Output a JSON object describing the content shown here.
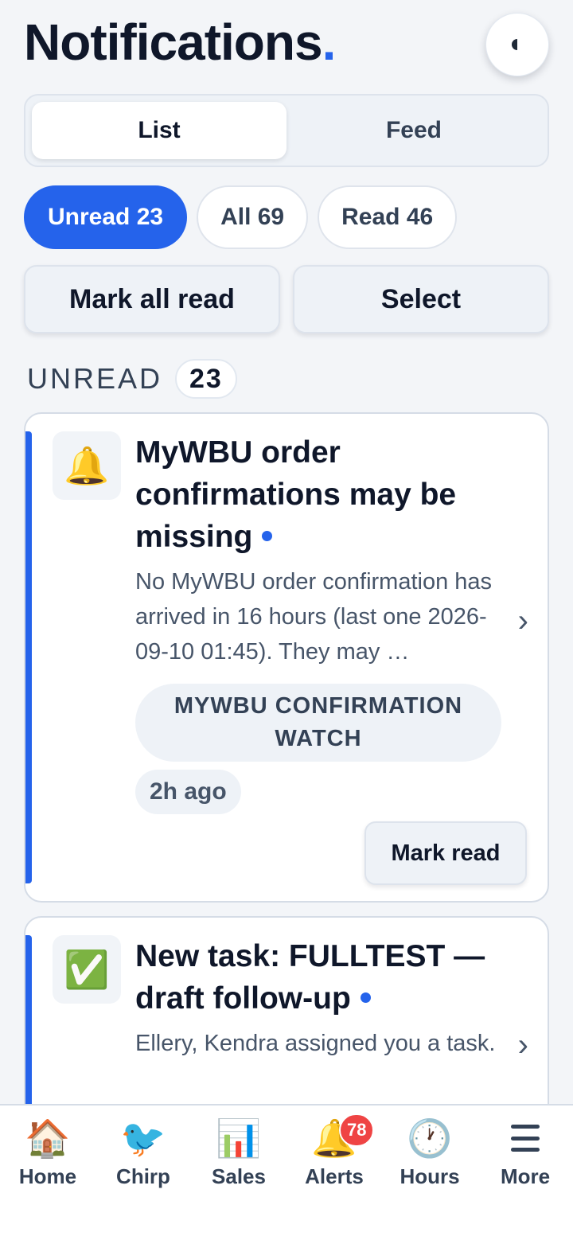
{
  "header": {
    "title": "Notifications",
    "title_dot": "."
  },
  "view_toggle": {
    "options": [
      "List",
      "Feed"
    ],
    "selected": "List"
  },
  "filters": [
    {
      "label": "Unread 23",
      "active": true
    },
    {
      "label": "All 69",
      "active": false
    },
    {
      "label": "Read 46",
      "active": false
    }
  ],
  "actions": {
    "mark_all_read": "Mark all read",
    "select": "Select"
  },
  "section": {
    "label": "UNREAD",
    "count": "23"
  },
  "notifications": [
    {
      "icon": "🔔",
      "icon_name": "bell-icon",
      "title": "MyWBU order confirmations may be missing",
      "body": "No MyWBU order confirmation has arrived in 16 hours (last one 2026-09-10 01:45). They may …",
      "tag": "MYWBU CONFIRMATION WATCH",
      "time": "2h ago",
      "action": "Mark read",
      "unread": true
    },
    {
      "icon": "✅",
      "icon_name": "check-mark-icon",
      "title": "New task: FULLTEST — draft follow-up",
      "body": "Ellery, Kendra assigned you a task.",
      "unread": true
    }
  ],
  "nav": [
    {
      "icon": "🏠",
      "icon_name": "home-icon",
      "label": "Home"
    },
    {
      "icon": "🐦",
      "icon_name": "bird-icon",
      "label": "Chirp"
    },
    {
      "icon": "📊",
      "icon_name": "bar-chart-icon",
      "label": "Sales"
    },
    {
      "icon": "🔔",
      "icon_name": "bell-icon",
      "label": "Alerts",
      "badge": "78"
    },
    {
      "icon": "🕐",
      "icon_name": "clock-icon",
      "label": "Hours"
    },
    {
      "icon_name": "menu-icon",
      "label": "More"
    }
  ],
  "colors": {
    "accent": "#2563eb",
    "badge": "#ef4444"
  }
}
